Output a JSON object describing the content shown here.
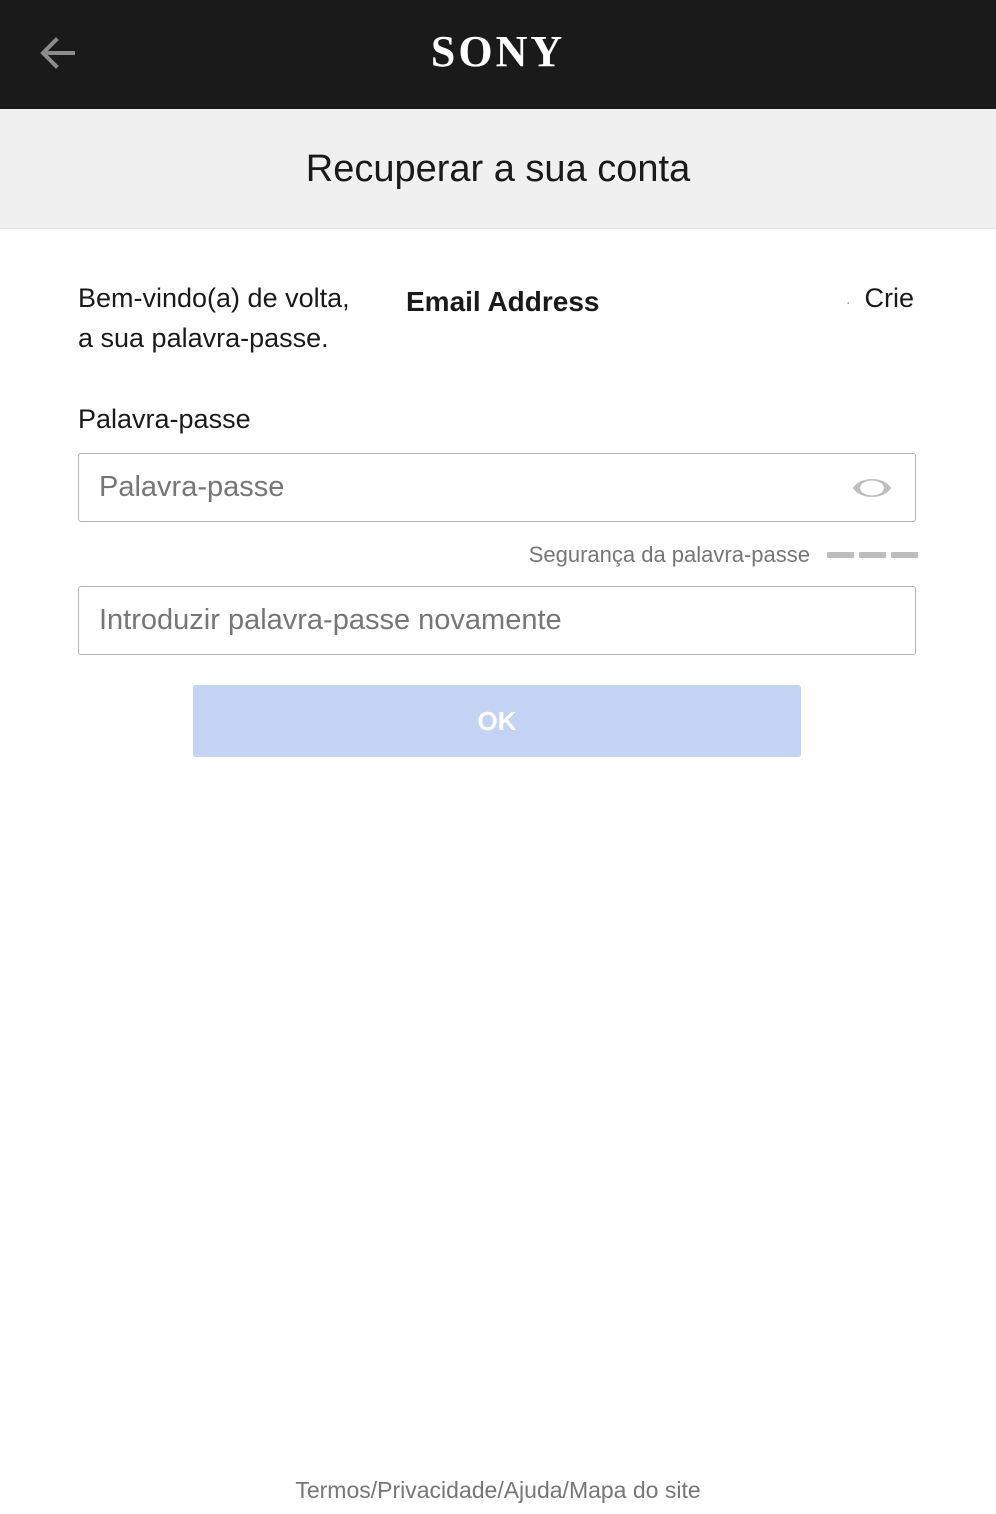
{
  "header": {
    "back_icon": "arrow-left-icon",
    "logo_text": "SONY"
  },
  "title": "Recuperar a sua conta",
  "welcome": {
    "line1_start": "Bem-vindo(a) de volta,",
    "email": "Email Address",
    "separator": ".",
    "line1_end": "Crie",
    "line2": "a sua palavra-passe."
  },
  "password": {
    "label": "Palavra-passe",
    "placeholder": "Palavra-passe",
    "value": "",
    "toggle_icon": "eye-icon"
  },
  "strength": {
    "label": "Segurança da palavra-passe",
    "filled_bars": 0,
    "total_bars": 3
  },
  "confirm": {
    "placeholder": "Introduzir palavra-passe novamente",
    "value": ""
  },
  "ok_button": {
    "label": "OK",
    "enabled": false
  },
  "footer": {
    "links": [
      "Termos",
      "Privacidade",
      "Ajuda",
      "Mapa do site"
    ],
    "separator": "/"
  },
  "colors": {
    "header_bg": "#1a1a1a",
    "titlebar_bg": "#f0f0f0",
    "button_disabled": "#c4d2f3",
    "muted_text": "#767676"
  }
}
